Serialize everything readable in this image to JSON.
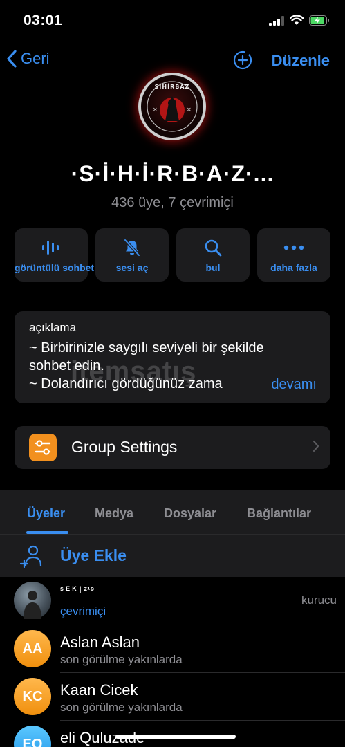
{
  "status_bar": {
    "time": "03:01"
  },
  "nav": {
    "back_label": "Geri",
    "edit_label": "Düzenle"
  },
  "group": {
    "title": "·S·İ·H·İ·R·B·A·Z·...",
    "subtitle": "436 üye, 7 çevrimiçi",
    "avatar_text": "SİHİRBAZ"
  },
  "actions": [
    {
      "label": "görüntülü sohbet",
      "icon": "voice-chat-icon"
    },
    {
      "label": "sesi aç",
      "icon": "bell-muted-icon"
    },
    {
      "label": "bul",
      "icon": "search-icon"
    },
    {
      "label": "daha fazla",
      "icon": "ellipsis-icon"
    }
  ],
  "description": {
    "label": "açıklama",
    "lines": [
      "~ Birbirinizle saygılı seviyeli bir şekilde",
      "sohbet edin.",
      "~ Dolandırıcı gördüğünüz zama"
    ],
    "more_label": "devamı",
    "watermark": "itemsatış"
  },
  "settings": {
    "label": "Group Settings"
  },
  "tabs": [
    {
      "label": "Üyeler",
      "active": true
    },
    {
      "label": "Medya",
      "active": false
    },
    {
      "label": "Dosyalar",
      "active": false
    },
    {
      "label": "Bağlantılar",
      "active": false
    }
  ],
  "add_member": {
    "label": "Üye Ekle"
  },
  "members": [
    {
      "name": "ˢ ᴱ ᴷ ǀ ᶻ¹⁹",
      "status": "çevrimiçi",
      "online": true,
      "role": "kurucu",
      "initials": "",
      "color": "#4a5560"
    },
    {
      "name": "Aslan Aslan",
      "status": "son görülme yakınlarda",
      "online": false,
      "role": "",
      "initials": "AA",
      "color": "#f5a623"
    },
    {
      "name": "Kaan Cicek",
      "status": "son görülme yakınlarda",
      "online": false,
      "role": "",
      "initials": "KC",
      "color": "#f5a623"
    },
    {
      "name": "eli Quluzade",
      "status": "",
      "online": false,
      "role": "",
      "initials": "EQ",
      "color": "#2fa8f0"
    }
  ],
  "colors": {
    "accent": "#3a8ef0",
    "card": "#1c1c1e",
    "settings_icon": "#f2901e"
  }
}
